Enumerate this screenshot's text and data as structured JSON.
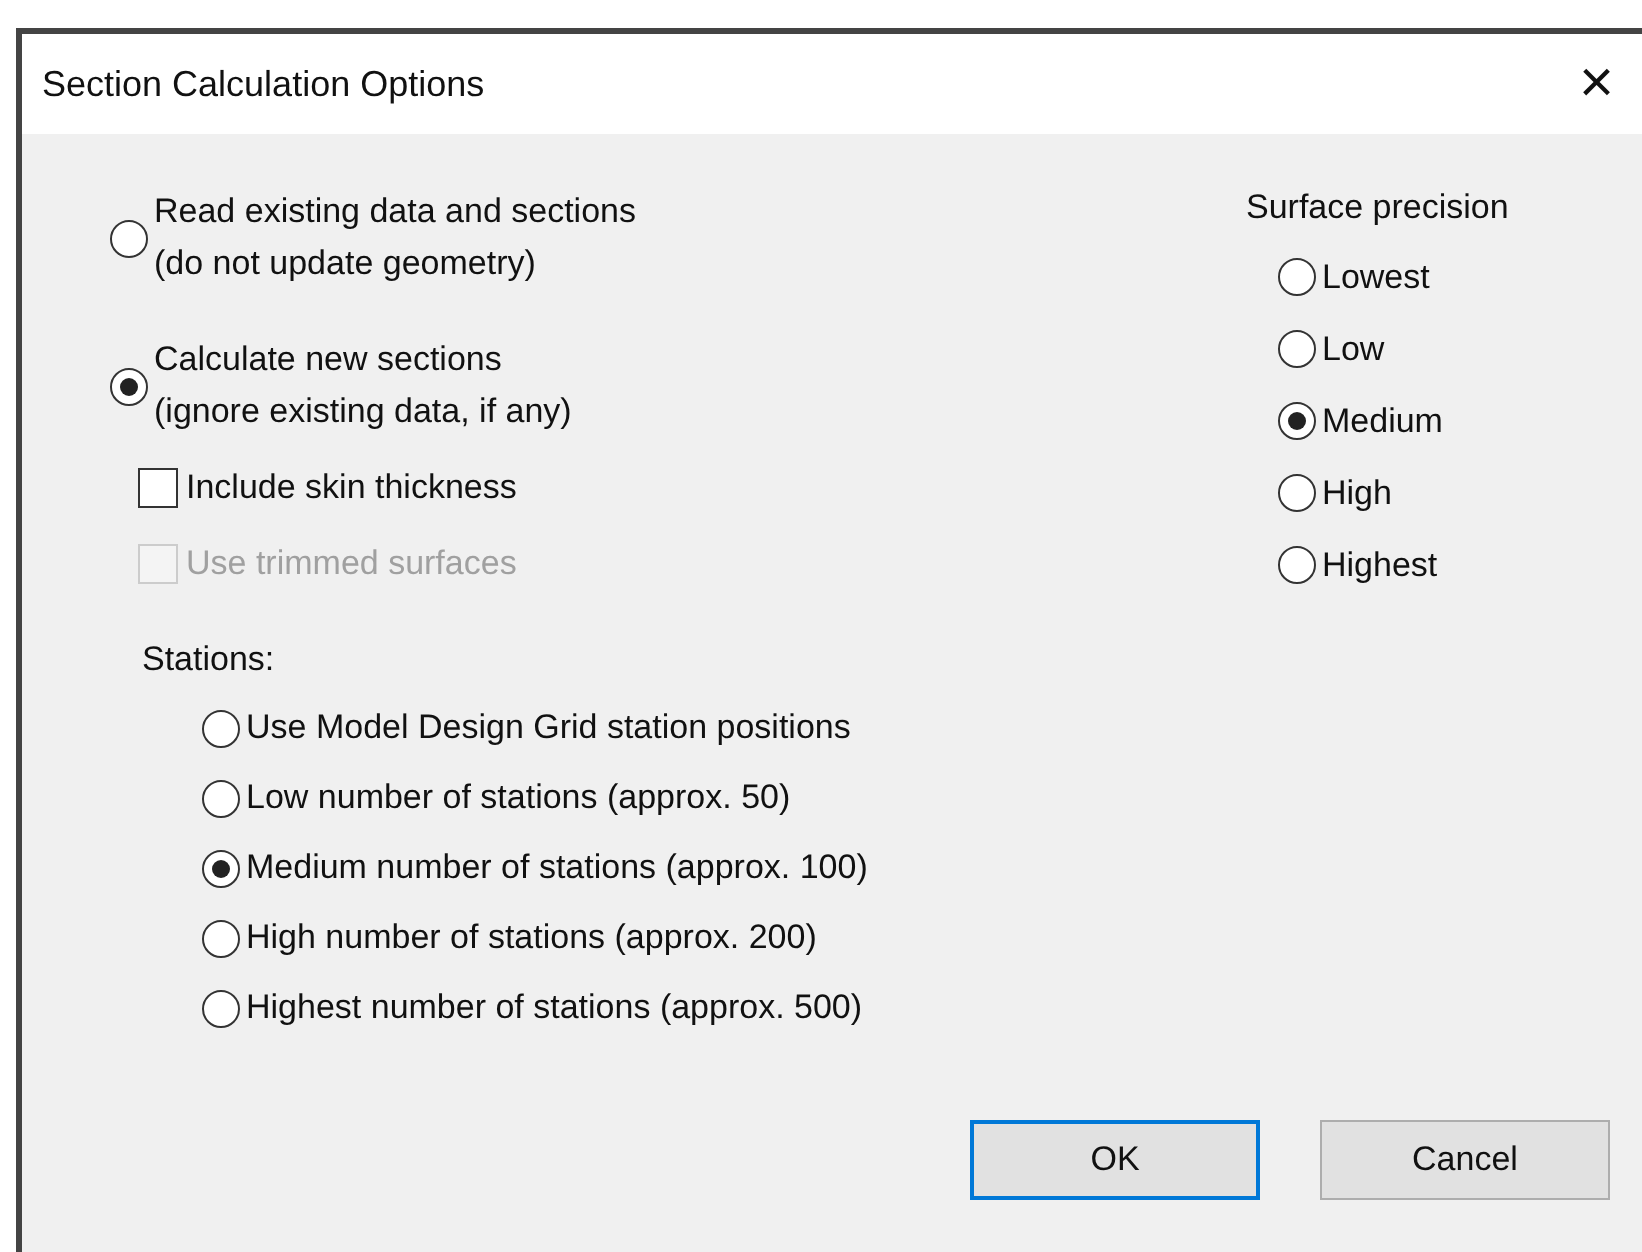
{
  "window": {
    "title": "Section Calculation Options",
    "close": "×"
  },
  "mode_options": [
    {
      "label": "Read existing data and sections",
      "sublabel": "(do not update geometry)",
      "selected": false
    },
    {
      "label": "Calculate new sections",
      "sublabel": "(ignore existing data, if any)",
      "selected": true
    }
  ],
  "checkboxes": [
    {
      "label": "Include skin thickness",
      "checked": false,
      "disabled": false
    },
    {
      "label": "Use trimmed surfaces",
      "checked": false,
      "disabled": true
    }
  ],
  "stations": {
    "label": "Stations:",
    "options": [
      {
        "label": "Use Model Design Grid station positions",
        "selected": false
      },
      {
        "label": "Low number of stations (approx. 50)",
        "selected": false
      },
      {
        "label": "Medium number of stations (approx. 100)",
        "selected": true
      },
      {
        "label": "High number of stations (approx. 200)",
        "selected": false
      },
      {
        "label": "Highest number of stations (approx. 500)",
        "selected": false
      }
    ]
  },
  "surface_precision": {
    "label": "Surface precision",
    "options": [
      {
        "label": "Lowest",
        "selected": false
      },
      {
        "label": "Low",
        "selected": false
      },
      {
        "label": "Medium",
        "selected": true
      },
      {
        "label": "High",
        "selected": false
      },
      {
        "label": "Highest",
        "selected": false
      }
    ]
  },
  "buttons": [
    {
      "label": "OK",
      "default": true
    },
    {
      "label": "Cancel",
      "default": false
    }
  ]
}
